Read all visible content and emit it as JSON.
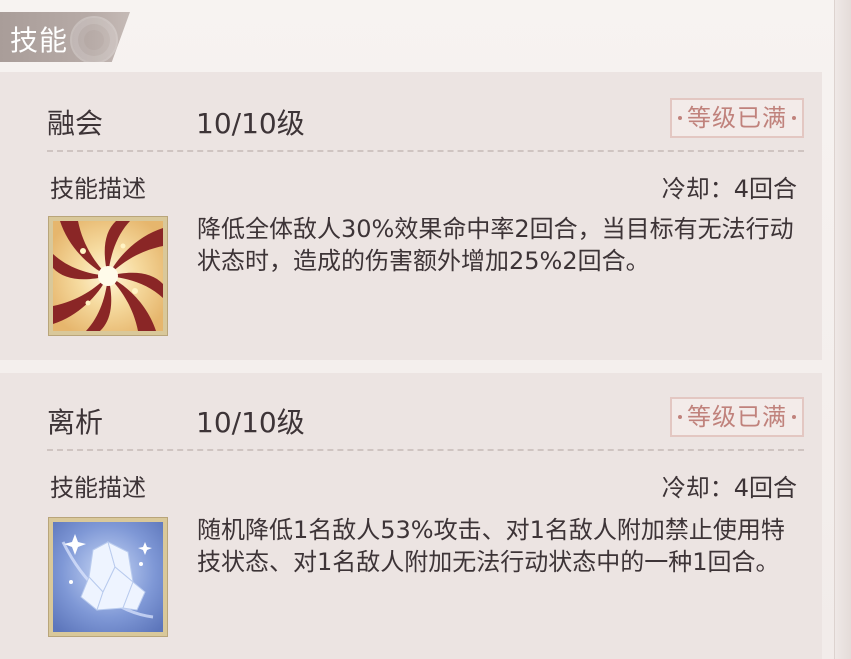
{
  "section": {
    "title": "技能"
  },
  "skills": [
    {
      "name": "融会",
      "level": "10/10级",
      "badge": "等级已满",
      "desc_label": "技能描述",
      "cooldown": "冷却：4回合",
      "description": "降低全体敌人30%效果命中率2回合，当目标有无法行动状态时，造成的伤害额外增加25%2回合。",
      "icon": "swirl-icon"
    },
    {
      "name": "离析",
      "level": "10/10级",
      "badge": "等级已满",
      "desc_label": "技能描述",
      "cooldown": "冷却：4回合",
      "description": "随机降低1名敌人53%攻击、对1名敌人附加禁止使用特技状态、对1名敌人附加无法行动状态中的一种1回合。",
      "icon": "crystal-icon"
    }
  ],
  "colors": {
    "text": "#3d3437",
    "badge": "#c0827c",
    "card_bg": "#ece4e2",
    "tab_bg": "#a99d99"
  }
}
